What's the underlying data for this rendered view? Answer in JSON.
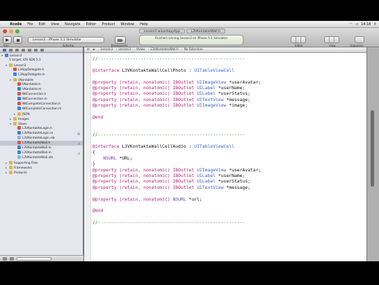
{
  "menubar": {
    "items": [
      "Xcode",
      "File",
      "Edit",
      "View",
      "Navigate",
      "Editor",
      "Product",
      "Window",
      "Help"
    ],
    "clock": "14:18"
  },
  "toolbar": {
    "tabs": [
      "Lesson3 wizardappApp",
      "L3VKontakteWall.h"
    ],
    "scheme": "Lesson3 › iPhone 5.1 Simulator",
    "status": "Finished running Lesson3 on iPhone 5.1 Simulator",
    "labels": {
      "run": "Run",
      "scheme": "Scheme",
      "breakpoints": "Breakpoints",
      "editor": "Editor",
      "view": "View",
      "organizer": "Organizer"
    }
  },
  "navigator": {
    "rows": [
      {
        "label": "Lesson3",
        "level": 0,
        "disclosure": "▾",
        "kind": "project",
        "selected": false,
        "badge": ""
      },
      {
        "label": "1 target, iOS SDK 5.1",
        "level": 1,
        "disclosure": "",
        "kind": "none",
        "selected": false,
        "badge": ""
      },
      {
        "label": "Lesson3",
        "level": 1,
        "disclosure": "▾",
        "kind": "folder",
        "selected": false,
        "badge": ""
      },
      {
        "label": "L3AppDelegate.h",
        "level": 2,
        "disclosure": "",
        "kind": "h",
        "selected": false,
        "badge": ""
      },
      {
        "label": "L3AppDelegate.m",
        "level": 2,
        "disclosure": "",
        "kind": "m",
        "selected": false,
        "badge": ""
      },
      {
        "label": "VKontakte",
        "level": 2,
        "disclosure": "▾",
        "kind": "folder",
        "selected": false,
        "badge": ""
      },
      {
        "label": "VKontakte.h",
        "level": 3,
        "disclosure": "",
        "kind": "h",
        "selected": false,
        "badge": ""
      },
      {
        "label": "VKontakte.m",
        "level": 3,
        "disclosure": "",
        "kind": "m",
        "selected": false,
        "badge": ""
      },
      {
        "label": "NKConnection.h",
        "level": 3,
        "disclosure": "",
        "kind": "h",
        "selected": false,
        "badge": ""
      },
      {
        "label": "NKConnection.m",
        "level": 3,
        "disclosure": "",
        "kind": "m",
        "selected": false,
        "badge": ""
      },
      {
        "label": "NKCompleteConnection.h",
        "level": 3,
        "disclosure": "",
        "kind": "h",
        "selected": false,
        "badge": ""
      },
      {
        "label": "NKCompleteConnection.m",
        "level": 3,
        "disclosure": "",
        "kind": "m",
        "selected": false,
        "badge": ""
      },
      {
        "label": "JSON",
        "level": 3,
        "disclosure": "▸",
        "kind": "folder",
        "selected": false,
        "badge": ""
      },
      {
        "label": "Images",
        "level": 2,
        "disclosure": "▸",
        "kind": "folder",
        "selected": false,
        "badge": ""
      },
      {
        "label": "Views",
        "level": 2,
        "disclosure": "▾",
        "kind": "folder",
        "selected": false,
        "badge": ""
      },
      {
        "label": "L3VKontakteLogin.h",
        "level": 3,
        "disclosure": "",
        "kind": "h",
        "selected": false,
        "badge": ""
      },
      {
        "label": "L3VKontakteLogin.m",
        "level": 3,
        "disclosure": "",
        "kind": "m",
        "selected": false,
        "badge": "M"
      },
      {
        "label": "L3VKontakteLogin.xib",
        "level": 3,
        "disclosure": "",
        "kind": "xib",
        "selected": false,
        "badge": ""
      },
      {
        "label": "L3VKontakteWall.h",
        "level": 3,
        "disclosure": "",
        "kind": "h",
        "selected": true,
        "badge": "A"
      },
      {
        "label": "L3VKontakteWall.m",
        "level": 3,
        "disclosure": "",
        "kind": "m",
        "selected": false,
        "badge": ""
      },
      {
        "label": "L3VKontakteWall.m",
        "level": 3,
        "disclosure": "",
        "kind": "m",
        "selected": false,
        "badge": "A"
      },
      {
        "label": "L3VKontakteWall.xib",
        "level": 3,
        "disclosure": "",
        "kind": "xib",
        "selected": false,
        "badge": ""
      },
      {
        "label": "Supporting Files",
        "level": 1,
        "disclosure": "▸",
        "kind": "folder",
        "selected": false,
        "badge": ""
      },
      {
        "label": "Frameworks",
        "level": 1,
        "disclosure": "▸",
        "kind": "folder",
        "selected": false,
        "badge": ""
      },
      {
        "label": "Products",
        "level": 1,
        "disclosure": "▸",
        "kind": "folder",
        "selected": false,
        "badge": ""
      }
    ]
  },
  "jumpbar": {
    "crumbs": [
      "Lesson3",
      "Lesson3",
      "Views",
      "L3VKontakteWall.h",
      "No Selection"
    ]
  },
  "code": {
    "lines": [
      [
        {
          "t": "//-------------------------------------------------------",
          "c": "cm"
        }
      ],
      [],
      [
        {
          "t": "@interface ",
          "c": "kw"
        },
        {
          "t": "L3VKontakteWallCellPhoto ",
          "c": "plain"
        },
        {
          "t": ": ",
          "c": "plain"
        },
        {
          "t": "UITableViewCell",
          "c": "cl"
        }
      ],
      [],
      [
        {
          "t": "@property ",
          "c": "kw"
        },
        {
          "t": "(retain, nonatomic) ",
          "c": "kw"
        },
        {
          "t": "IBOutlet ",
          "c": "kw"
        },
        {
          "t": "UIImageView ",
          "c": "cl"
        },
        {
          "t": "*userAvatar;",
          "c": "plain"
        }
      ],
      [
        {
          "t": "@property ",
          "c": "kw"
        },
        {
          "t": "(retain, nonatomic) ",
          "c": "kw"
        },
        {
          "t": "IBOutlet ",
          "c": "kw"
        },
        {
          "t": "UILabel ",
          "c": "cl"
        },
        {
          "t": "*userName;",
          "c": "plain"
        }
      ],
      [
        {
          "t": "@property ",
          "c": "kw"
        },
        {
          "t": "(retain, nonatomic) ",
          "c": "kw"
        },
        {
          "t": "IBOutlet ",
          "c": "kw"
        },
        {
          "t": "UILabel ",
          "c": "cl"
        },
        {
          "t": "*userStatus;",
          "c": "plain"
        }
      ],
      [
        {
          "t": "@property ",
          "c": "kw"
        },
        {
          "t": "(retain, nonatomic) ",
          "c": "kw"
        },
        {
          "t": "IBOutlet ",
          "c": "kw"
        },
        {
          "t": "UITextView ",
          "c": "cl"
        },
        {
          "t": "*message;",
          "c": "plain"
        }
      ],
      [
        {
          "t": "@property ",
          "c": "kw"
        },
        {
          "t": "(retain, nonatomic) ",
          "c": "kw"
        },
        {
          "t": "IBOutlet ",
          "c": "kw"
        },
        {
          "t": "UIImageView ",
          "c": "cl"
        },
        {
          "t": "*image;",
          "c": "plain"
        }
      ],
      [],
      [
        {
          "t": "@end",
          "c": "kw"
        }
      ],
      [],
      [],
      [
        {
          "t": "//-------------------------------------------------------",
          "c": "cm"
        }
      ],
      [],
      [
        {
          "t": "@interface ",
          "c": "kw"
        },
        {
          "t": "L3VKontakteWallCellAudio ",
          "c": "plain"
        },
        {
          "t": ": ",
          "c": "plain"
        },
        {
          "t": "UITableViewCell",
          "c": "cl"
        }
      ],
      [
        {
          "t": "{",
          "c": "plain"
        }
      ],
      [
        {
          "t": "    NSURL ",
          "c": "ty"
        },
        {
          "t": "*URL;",
          "c": "plain"
        }
      ],
      [
        {
          "t": "}",
          "c": "plain"
        }
      ],
      [
        {
          "t": "@property ",
          "c": "kw"
        },
        {
          "t": "(retain, nonatomic) ",
          "c": "kw"
        },
        {
          "t": "IBOutlet ",
          "c": "kw"
        },
        {
          "t": "UIImageView ",
          "c": "cl"
        },
        {
          "t": "*userAvatar;",
          "c": "plain"
        }
      ],
      [
        {
          "t": "@property ",
          "c": "kw"
        },
        {
          "t": "(retain, nonatomic) ",
          "c": "kw"
        },
        {
          "t": "IBOutlet ",
          "c": "kw"
        },
        {
          "t": "UILabel ",
          "c": "cl"
        },
        {
          "t": "*userName;",
          "c": "plain"
        }
      ],
      [
        {
          "t": "@property ",
          "c": "kw"
        },
        {
          "t": "(retain, nonatomic) ",
          "c": "kw"
        },
        {
          "t": "IBOutlet ",
          "c": "kw"
        },
        {
          "t": "UILabel ",
          "c": "cl"
        },
        {
          "t": "*userStatus;",
          "c": "plain"
        }
      ],
      [
        {
          "t": "@property ",
          "c": "kw"
        },
        {
          "t": "(retain, nonatomic) ",
          "c": "kw"
        },
        {
          "t": "IBOutlet ",
          "c": "kw"
        },
        {
          "t": "UITextView ",
          "c": "cl"
        },
        {
          "t": "*message;",
          "c": "plain"
        }
      ],
      [],
      [
        {
          "t": "@property ",
          "c": "kw"
        },
        {
          "t": "(retain, nonatomic) ",
          "c": "kw"
        },
        {
          "t": "NSURL ",
          "c": "ty"
        },
        {
          "t": "*url;",
          "c": "plain"
        }
      ],
      [],
      [
        {
          "t": "@end",
          "c": "kw"
        }
      ],
      [],
      [
        {
          "t": "//-------------------------------------------------------",
          "c": "cm"
        }
      ]
    ]
  },
  "colors": {
    "comment": "#1f8a1f",
    "keyword": "#b2217f",
    "class": "#3a5fcd",
    "type": "#6b3ea8",
    "selection": "#c1c8d3"
  },
  "dock": {
    "icons": [
      "finder-icon",
      "dashboard-icon",
      "chrome-icon",
      "firefox-icon",
      "ios-simulator-icon",
      "folder-icon",
      "stickies-icon",
      "preview-icon",
      "terminal-icon",
      "xcode-icon"
    ]
  }
}
